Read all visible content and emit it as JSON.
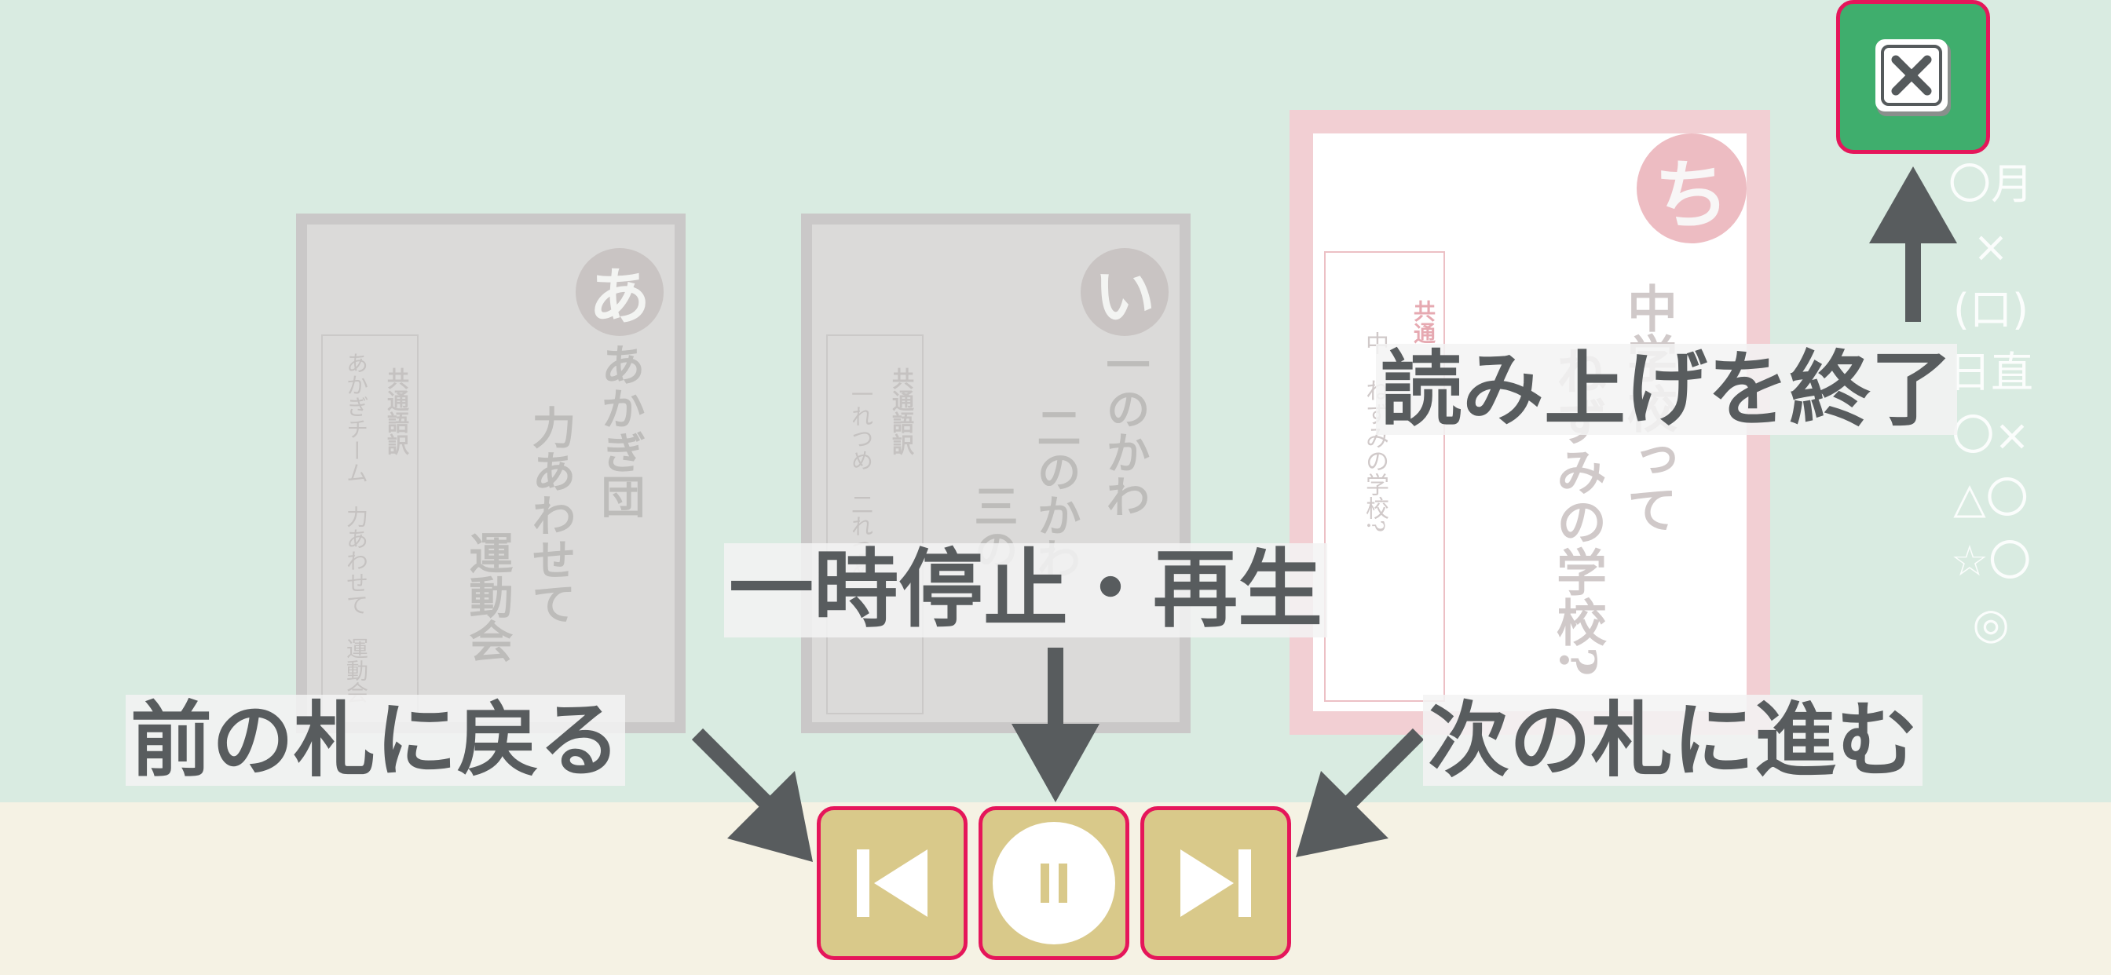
{
  "cards": [
    {
      "badge": "あ",
      "main_lines": [
        "あかぎ団",
        "力あわせて",
        "運動会"
      ],
      "translation_heading": "共通語訳",
      "translation": "あかぎチーム　力あわせて　運動会"
    },
    {
      "badge": "い",
      "main_lines": [
        "一のかわ",
        "二のかわ",
        "三の"
      ],
      "translation_heading": "共通語訳",
      "translation": "一れつめ　二れつめ"
    },
    {
      "badge": "ち",
      "main_lines": [
        "中学校って",
        "ねずみの学校?"
      ],
      "translation_heading": "共通",
      "translation": "中　ねずみの学校?"
    }
  ],
  "controls": {
    "prev_icon": "skip-previous-icon",
    "pause_icon": "pause-icon",
    "next_icon": "skip-next-icon",
    "close_icon": "close-icon"
  },
  "labels": {
    "close": "読み上げを終了",
    "pause": "一時停止・再生",
    "prev": "前の札に戻る",
    "next": "次の札に進む"
  },
  "scoreboard": [
    "〇月",
    "×",
    "(口)",
    "日直",
    "〇×",
    "△〇",
    "☆〇",
    "◎"
  ],
  "colors": {
    "wall": "#d9ebe1",
    "floor": "#f5f2e4",
    "control": "#d9c98a",
    "highlight": "#e5165a",
    "close": "#3fae6d",
    "label_text": "#585c5e"
  }
}
